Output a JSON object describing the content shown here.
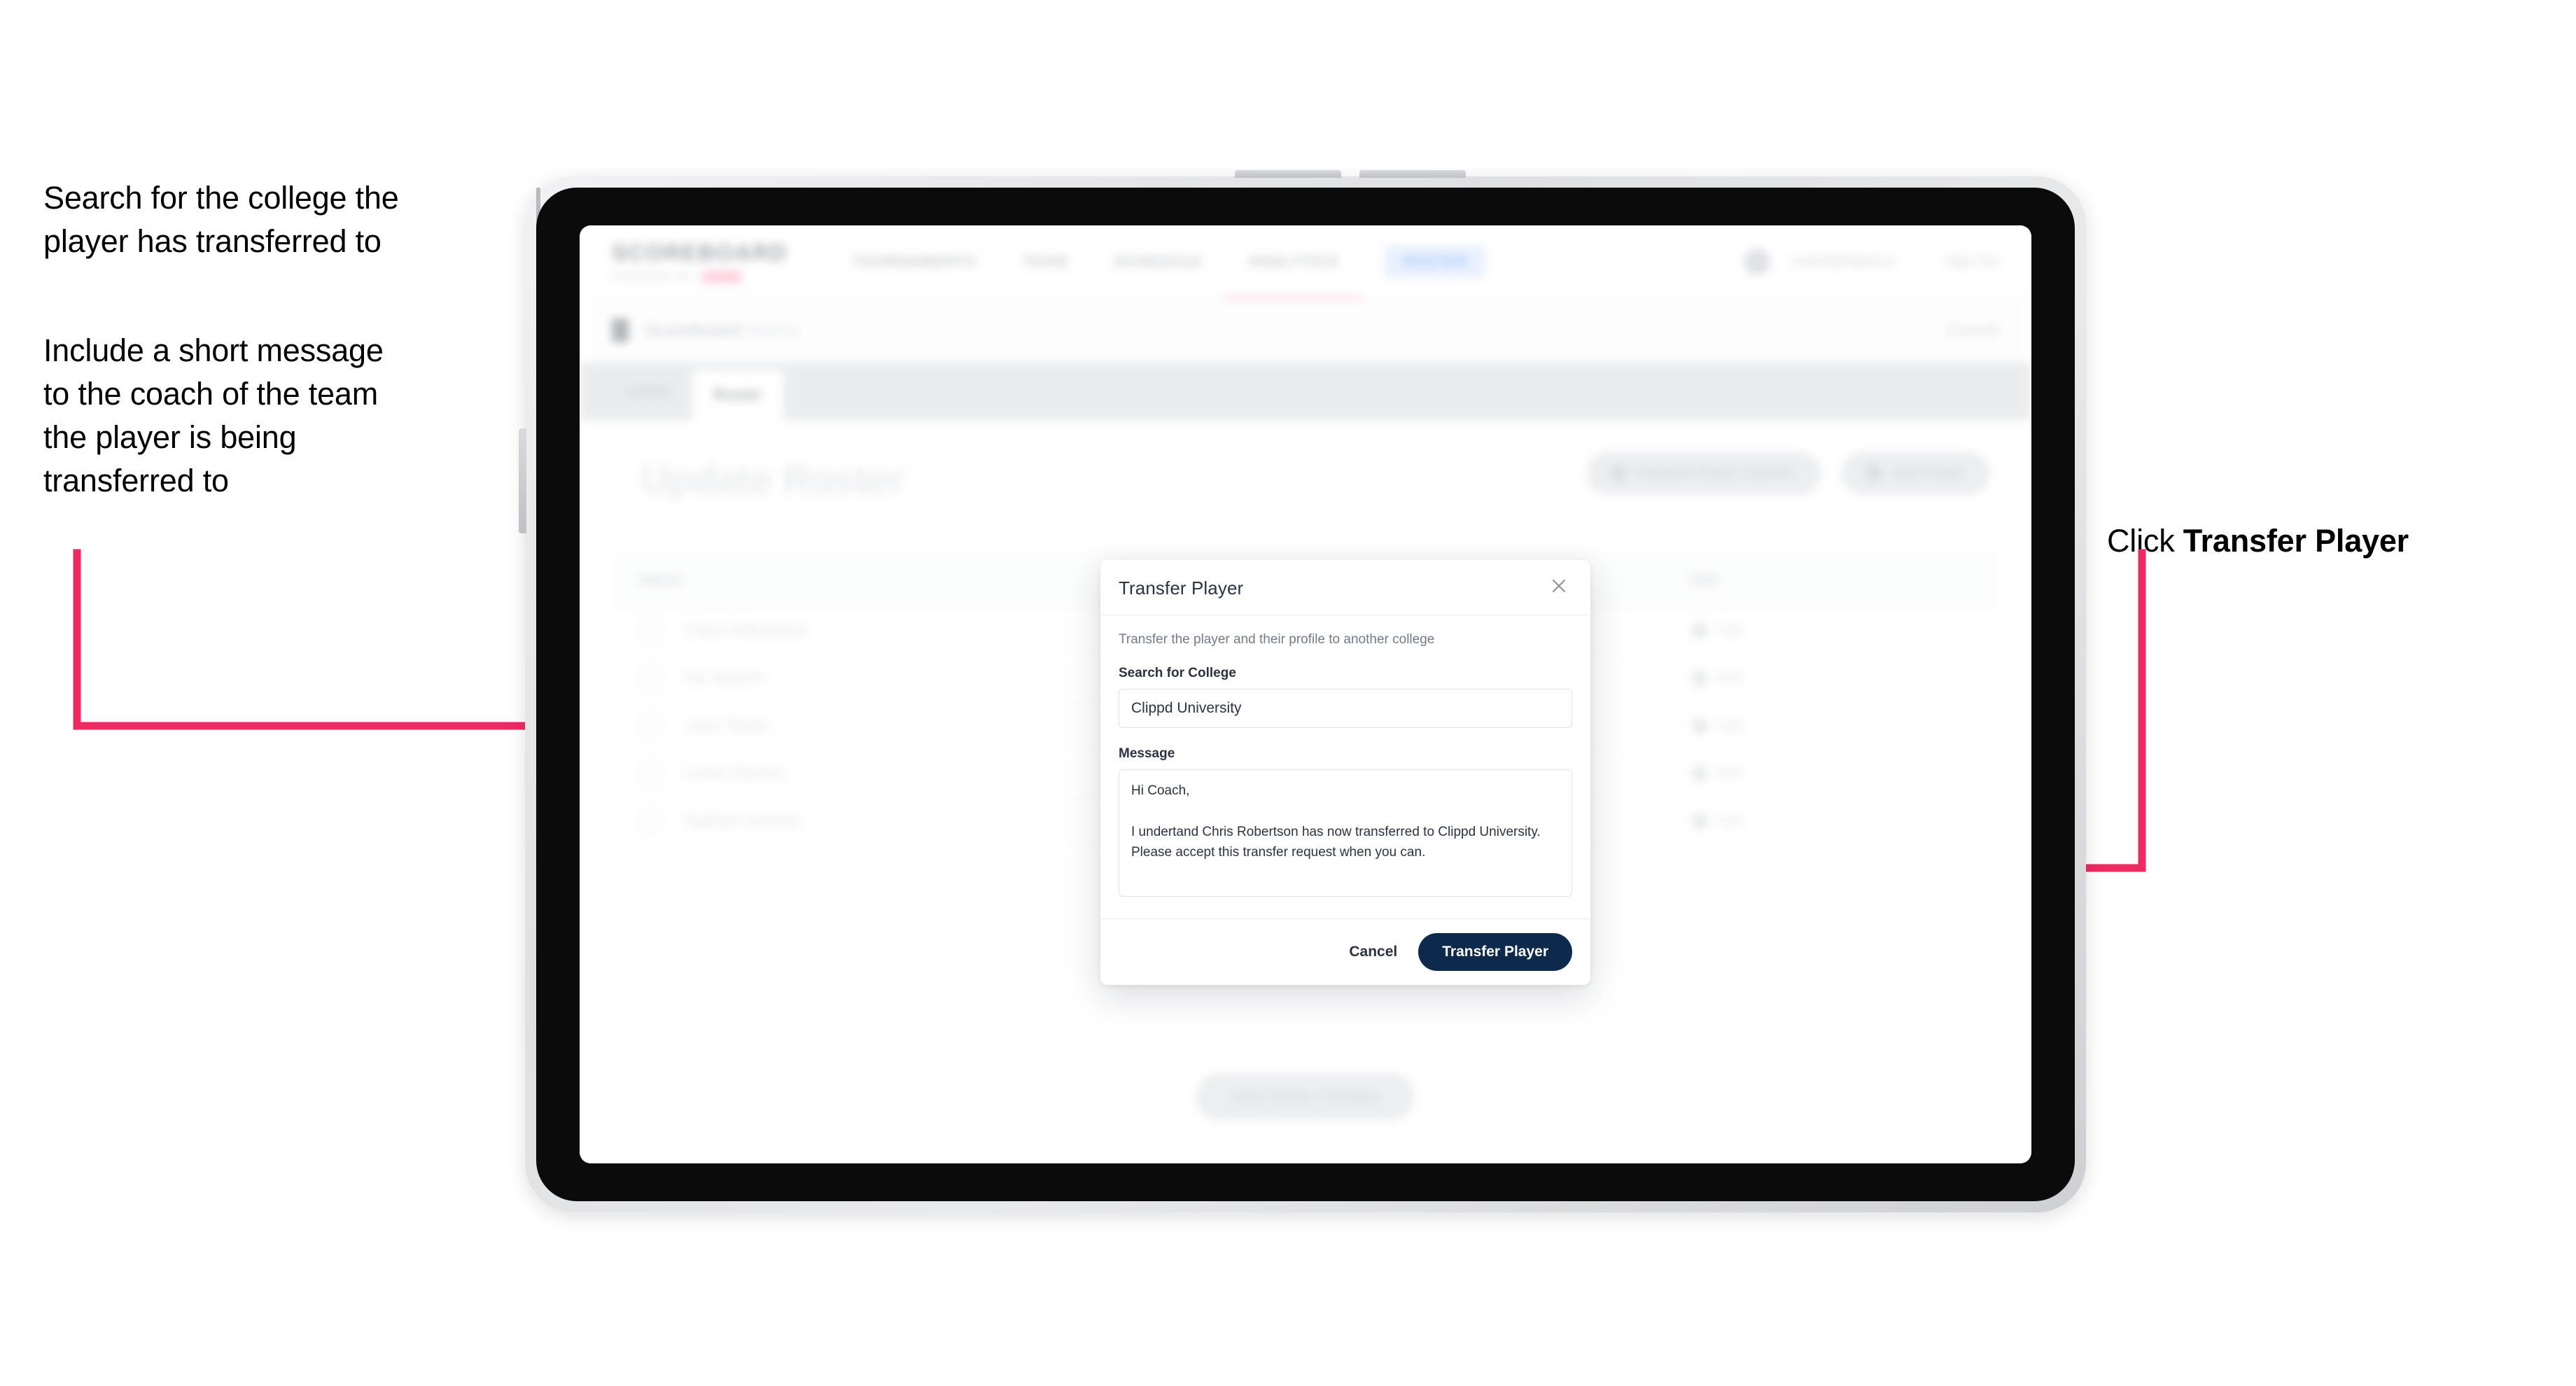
{
  "annotations": {
    "left_1": "Search for the college the\nplayer has transferred to",
    "left_2": "Include a short message\nto the coach of the team\nthe player is being\ntransferred to",
    "right_prefix": "Click ",
    "right_bold": "Transfer Player"
  },
  "colors": {
    "arrow_pink": "#EE2A62",
    "brand_pink": "#FF3D71",
    "primary_navy": "#0D2A4D",
    "device_bezel": "#0B0B0B"
  },
  "app": {
    "logo": {
      "word": "SCOREBOARD",
      "subtitle": "POWERED BY",
      "sub_badge": "clippd"
    },
    "nav": [
      {
        "label": "TOURNAMENTS",
        "active": false
      },
      {
        "label": "TEAM",
        "active": false
      },
      {
        "label": "SCHEDULE",
        "active": false
      },
      {
        "label": "ANALYTICS",
        "active": false
      },
      {
        "label": "ROSTER",
        "active": true
      }
    ],
    "user": {
      "email": "coach@clippd.io",
      "signout_label": "Sign Out"
    },
    "breadcrumb": {
      "text": "Scoreboard",
      "muted": "Admin",
      "right_action": "Cancel"
    },
    "tabs": [
      {
        "label": "Details",
        "active": false
      },
      {
        "label": "Roster",
        "active": true
      }
    ],
    "page_title": "Update Roster",
    "actions": [
      {
        "label": "Request Player Transfer"
      },
      {
        "label": "Add Player"
      }
    ],
    "roster": {
      "columns": [
        "Name",
        "Edit"
      ],
      "rows": [
        {
          "name": "Chris Robertson",
          "edit": "Edit"
        },
        {
          "name": "Ian Wilson",
          "edit": "Edit"
        },
        {
          "name": "John Taylor",
          "edit": "Edit"
        },
        {
          "name": "Lewis Barnes",
          "edit": "Edit"
        },
        {
          "name": "Nathan Holmes",
          "edit": "Edit"
        }
      ]
    },
    "bottom_cta": "Save Roster Changes"
  },
  "modal": {
    "title": "Transfer Player",
    "close_icon": "close-icon",
    "description": "Transfer the player and their profile to another college",
    "college_field": {
      "label": "Search for College",
      "value": "Clippd University",
      "placeholder": "Search for College"
    },
    "message_field": {
      "label": "Message",
      "value": "Hi Coach,\n\nI undertand Chris Robertson has now transferred to Clippd University. Please accept this transfer request when you can.",
      "placeholder": "Message"
    },
    "cancel_label": "Cancel",
    "submit_label": "Transfer Player"
  }
}
